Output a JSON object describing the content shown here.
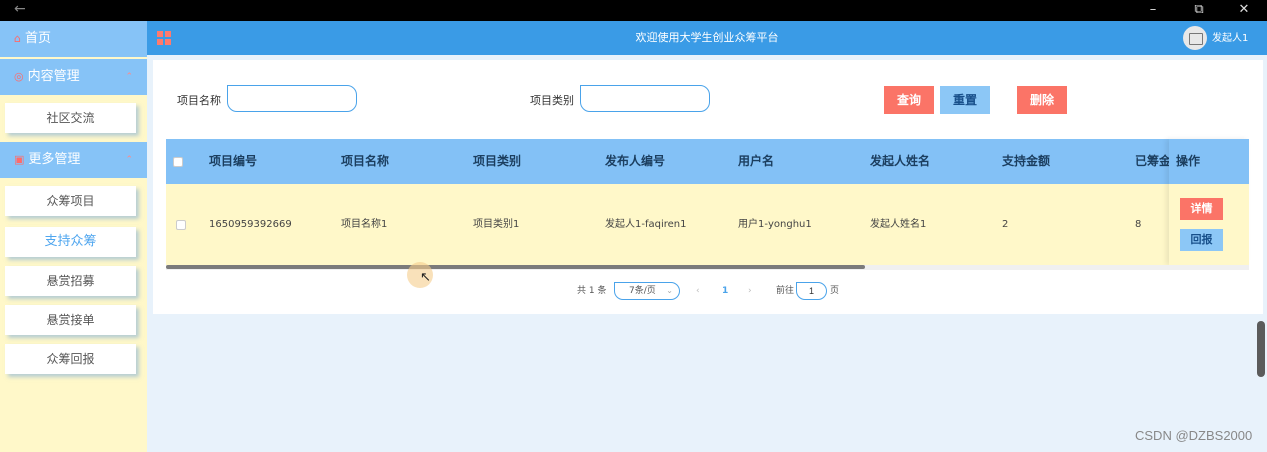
{
  "window": {
    "back_glyph": "←",
    "min_glyph": "–",
    "restore_glyph": "⧉",
    "close_glyph": "✕"
  },
  "sidebar": {
    "home": {
      "label": "首页",
      "icon": "home-icon"
    },
    "groups": [
      {
        "label": "内容管理",
        "icon": "content-icon",
        "items": [
          "社区交流"
        ]
      },
      {
        "label": "更多管理",
        "icon": "more-icon",
        "items": [
          "众筹项目",
          "支持众筹",
          "悬赏招募",
          "悬赏接单",
          "众筹回报"
        ],
        "active": "支持众筹"
      }
    ],
    "accent": "#86c3f7"
  },
  "header": {
    "title": "欢迎使用大学生创业众筹平台",
    "user": "发起人1",
    "accent": "#3a9be6"
  },
  "filters": {
    "name_label": "项目名称",
    "name_value": "",
    "type_label": "项目类别",
    "type_value": "",
    "search_button": "查询",
    "reset_button": "重置",
    "delete_button": "删除"
  },
  "table": {
    "headers": [
      "项目编号",
      "项目名称",
      "项目类别",
      "发布人编号",
      "用户名",
      "发起人姓名",
      "支持金额",
      "已筹金"
    ],
    "ops_header": "操作",
    "rows": [
      {
        "cells": [
          "1650959392669",
          "项目名称1",
          "项目类别1",
          "发起人1-faqiren1",
          "用户1-yonghu1",
          "发起人姓名1",
          "2",
          "8"
        ],
        "actions": [
          "详情",
          "回报"
        ]
      }
    ]
  },
  "pagination": {
    "total": "共 1 条",
    "page_size": "7条/页",
    "prev": "‹",
    "current": "1",
    "next": "›",
    "goto_label": "前往",
    "goto_value": "1",
    "page_unit": "页"
  },
  "watermark": "CSDN @DZBS2000"
}
